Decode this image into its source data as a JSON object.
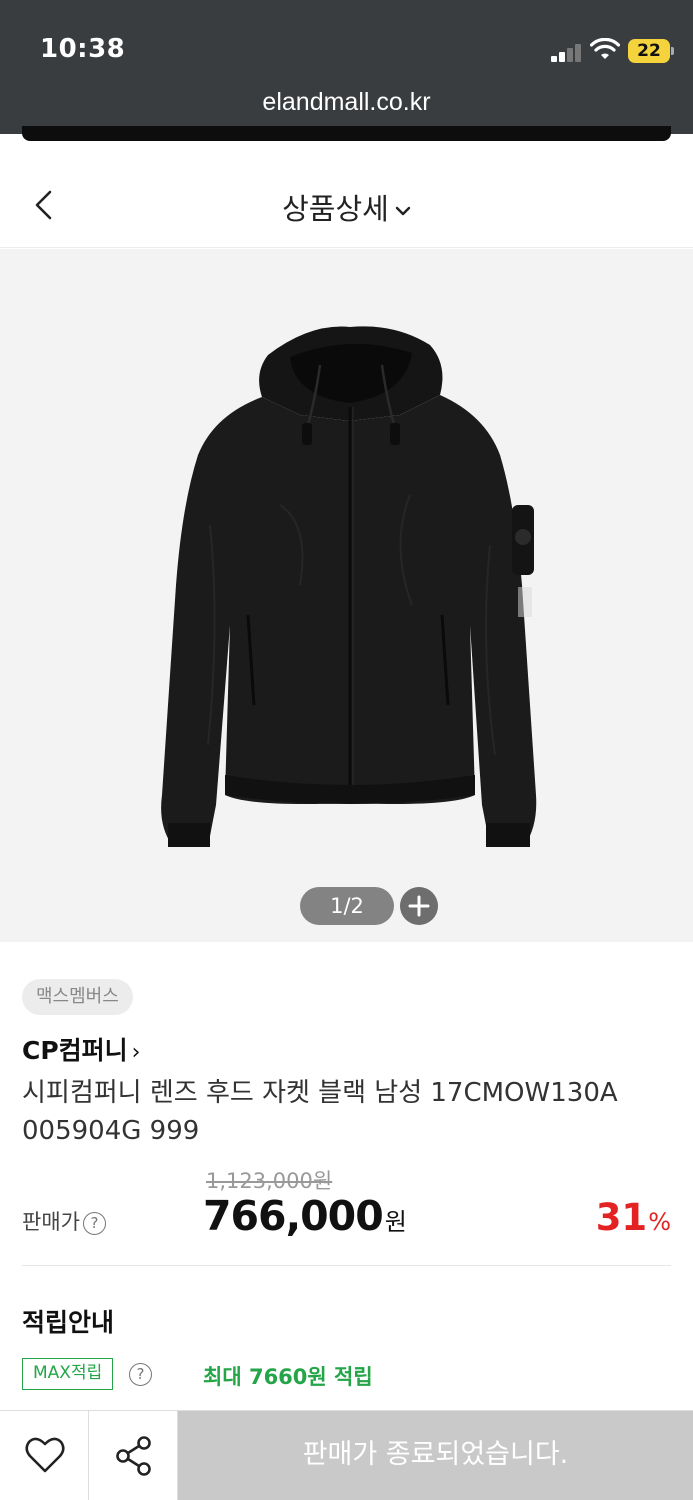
{
  "status_bar": {
    "time": "10:38",
    "battery": "22"
  },
  "browser": {
    "url": "elandmall.co.kr"
  },
  "header": {
    "title": "상품상세"
  },
  "gallery": {
    "pager": "1/2"
  },
  "product": {
    "badge": "맥스멤버스",
    "brand": "CP컴퍼니",
    "brand_arrow": "›",
    "name": "시피컴퍼니 렌즈 후드 자켓 블랙 남성 17CMOW130A 005904G 999",
    "original_price": "1,123,000원",
    "price_label": "판매가",
    "price": "766,000",
    "price_unit": "원",
    "discount": "31",
    "discount_unit": "%"
  },
  "points": {
    "section_title": "적립안내",
    "max_tag": "MAX적립",
    "max_text": "최대 7660원 적립"
  },
  "bottom_bar": {
    "soldout_label": "판매가 종료되었습니다."
  },
  "colors": {
    "topbar": "#3a3d3f",
    "discount_red": "#e32323",
    "points_green": "#23a548",
    "soldout_gray": "#c9c9c9"
  },
  "icons": [
    "back-chevron-icon",
    "dropdown-chevron-icon",
    "help-icon",
    "plus-icon",
    "heart-icon",
    "share-icon",
    "wifi-icon",
    "signal-icon"
  ]
}
